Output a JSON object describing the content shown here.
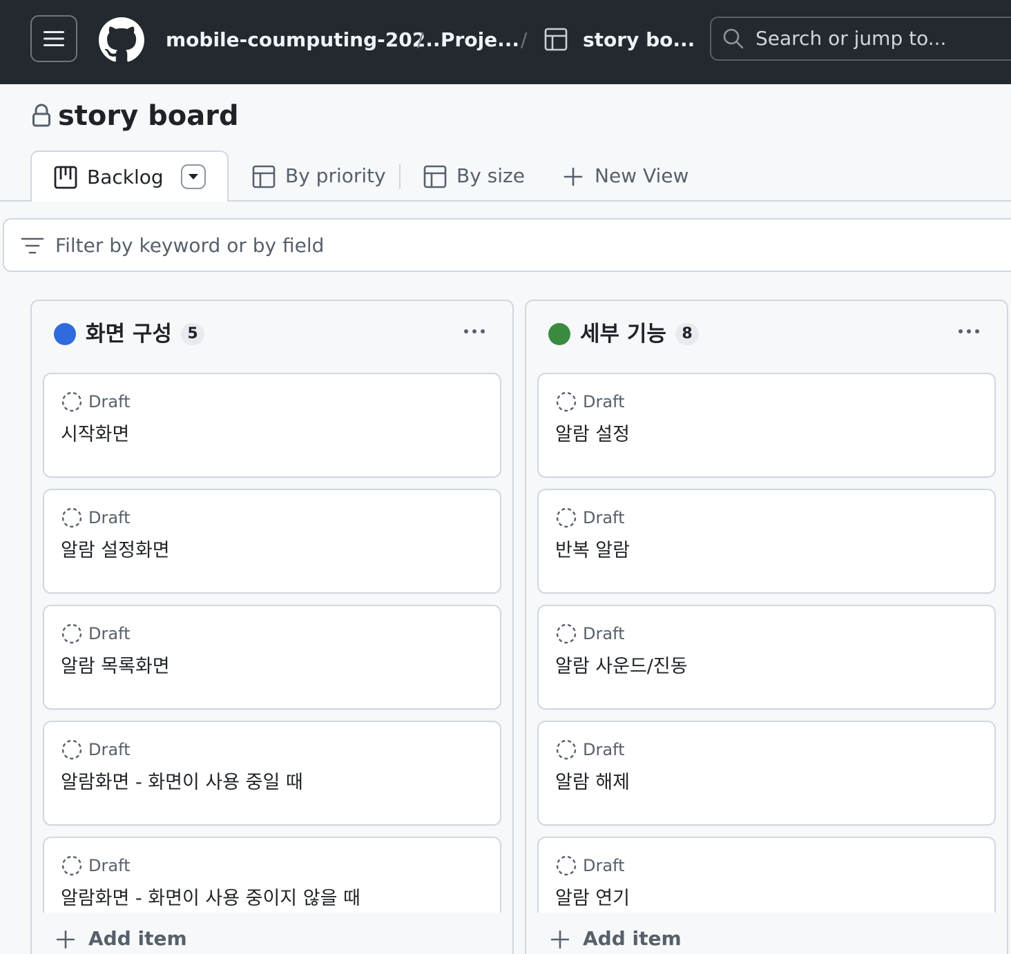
{
  "header": {
    "repo": "mobile-coumputing-202...",
    "projects": "Proje...",
    "project": "story bo...",
    "separator": "/",
    "search_placeholder": "Search or jump to..."
  },
  "project": {
    "title": "story board"
  },
  "views": {
    "tabs": [
      {
        "label": "Backlog",
        "icon": "board-icon",
        "active": true
      },
      {
        "label": "By priority",
        "icon": "table-icon",
        "active": false
      },
      {
        "label": "By size",
        "icon": "table-icon",
        "active": false
      }
    ],
    "new_view": "New View"
  },
  "filter": {
    "placeholder": "Filter by keyword or by field"
  },
  "columns": [
    {
      "title": "화면 구성",
      "count": "5",
      "color": "#2f6bdd",
      "cards": [
        {
          "status": "Draft",
          "title": "시작화면"
        },
        {
          "status": "Draft",
          "title": "알람 설정화면"
        },
        {
          "status": "Draft",
          "title": "알람 목록화면"
        },
        {
          "status": "Draft",
          "title": "알람화면 - 화면이 사용 중일 때"
        },
        {
          "status": "Draft",
          "title": "알람화면 - 화면이 사용 중이지 않을 때"
        }
      ],
      "add_item": "Add item"
    },
    {
      "title": "세부 기능",
      "count": "8",
      "color": "#3a8a3f",
      "cards": [
        {
          "status": "Draft",
          "title": "알람 설정"
        },
        {
          "status": "Draft",
          "title": "반복 알람"
        },
        {
          "status": "Draft",
          "title": "알람 사운드/진동"
        },
        {
          "status": "Draft",
          "title": "알람 해제"
        },
        {
          "status": "Draft",
          "title": "알람 연기"
        }
      ],
      "add_item": "Add item"
    }
  ]
}
